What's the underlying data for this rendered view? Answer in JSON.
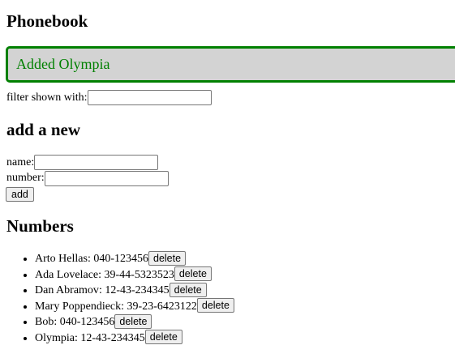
{
  "app": {
    "title": "Phonebook"
  },
  "notification": {
    "message": "Added Olympia",
    "type": "success",
    "color": "#008000",
    "background": "#d3d3d3"
  },
  "filter": {
    "label": "filter shown with:",
    "value": ""
  },
  "add_form": {
    "heading": "add a new",
    "name_label": "name:",
    "name_value": "",
    "number_label": "number:",
    "number_value": "",
    "submit_label": "add"
  },
  "numbers": {
    "heading": "Numbers",
    "delete_label": "delete",
    "persons": [
      {
        "name": "Arto Hellas",
        "number": "040-123456"
      },
      {
        "name": "Ada Lovelace",
        "number": "39-44-5323523"
      },
      {
        "name": "Dan Abramov",
        "number": "12-43-234345"
      },
      {
        "name": "Mary Poppendieck",
        "number": "39-23-6423122"
      },
      {
        "name": "Bob",
        "number": "040-123456"
      },
      {
        "name": "Olympia",
        "number": "12-43-234345"
      }
    ]
  }
}
